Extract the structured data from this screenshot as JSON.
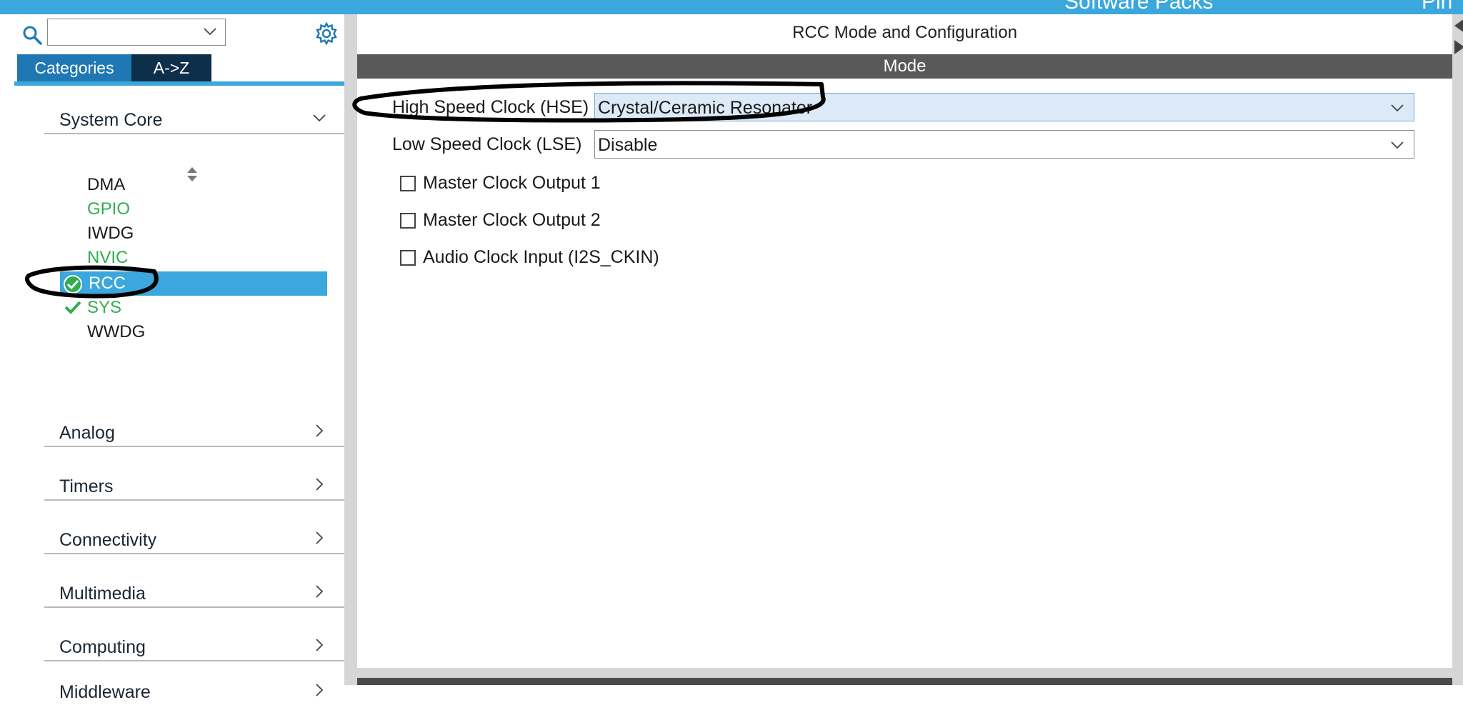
{
  "topbar": {
    "items": [
      "Software Packs",
      "Pin"
    ],
    "color": "#3ba7dc"
  },
  "left_panel": {
    "search": {
      "value": "",
      "placeholder": ""
    },
    "tabs": [
      "Categories",
      "A->Z"
    ],
    "active_tab": "Categories",
    "categories": [
      {
        "label": "System Core",
        "expanded": true
      },
      {
        "label": "Analog",
        "expanded": false
      },
      {
        "label": "Timers",
        "expanded": false
      },
      {
        "label": "Connectivity",
        "expanded": false
      },
      {
        "label": "Multimedia",
        "expanded": false
      },
      {
        "label": "Computing",
        "expanded": false
      },
      {
        "label": "Middleware",
        "expanded": false
      }
    ],
    "system_core_items": [
      {
        "label": "DMA",
        "status": "none"
      },
      {
        "label": "GPIO",
        "status": "configured"
      },
      {
        "label": "IWDG",
        "status": "none"
      },
      {
        "label": "NVIC",
        "status": "configured"
      },
      {
        "label": "RCC",
        "status": "selected-ok"
      },
      {
        "label": "SYS",
        "status": "ok"
      },
      {
        "label": "WWDG",
        "status": "none"
      }
    ],
    "colors": {
      "configured": "#2fae4f",
      "selected": "#3ba7dc"
    }
  },
  "right_panel": {
    "title": "RCC Mode and Configuration",
    "mode_header": "Mode",
    "hse": {
      "label": "High Speed Clock (HSE)",
      "value": "Crystal/Ceramic Resonator"
    },
    "lse": {
      "label": "Low Speed Clock (LSE)",
      "value": "Disable"
    },
    "checkboxes": [
      {
        "label": "Master Clock Output 1",
        "checked": false
      },
      {
        "label": "Master Clock Output 2",
        "checked": false
      },
      {
        "label": "Audio Clock Input (I2S_CKIN)",
        "checked": false
      }
    ]
  }
}
